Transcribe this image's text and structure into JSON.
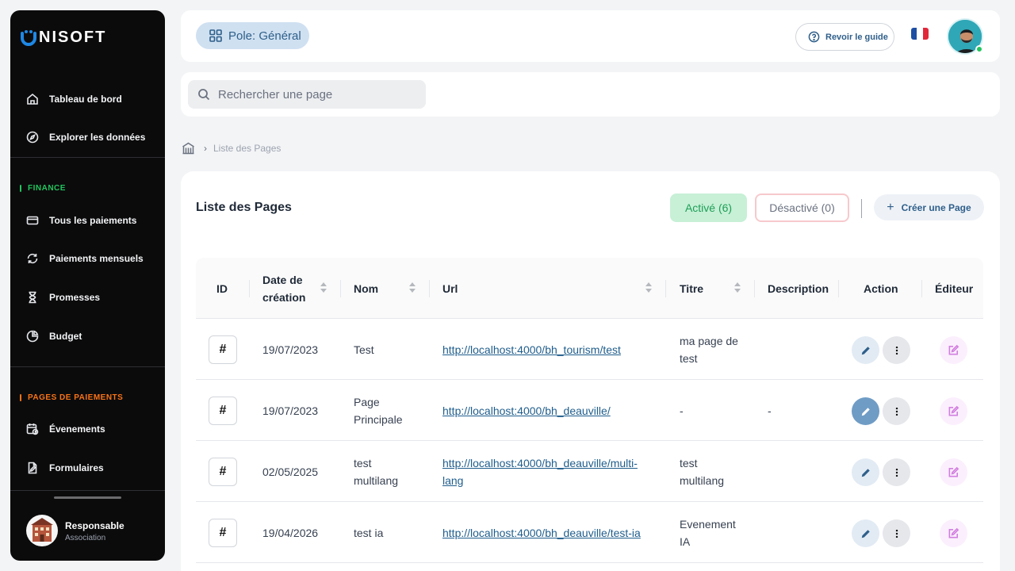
{
  "brand": {
    "name": "NISOFT"
  },
  "sidebar": {
    "top_items": [
      {
        "label": "Tableau de bord",
        "icon": "home-icon"
      },
      {
        "label": "Explorer les données",
        "icon": "compass-icon"
      }
    ],
    "sections": [
      {
        "title": "FINANCE",
        "color": "#22c55e",
        "items": [
          {
            "label": "Tous les paiements",
            "icon": "credit-card-icon"
          },
          {
            "label": "Paiements mensuels",
            "icon": "refresh-icon"
          },
          {
            "label": "Promesses",
            "icon": "hourglass-icon"
          },
          {
            "label": "Budget",
            "icon": "pie-chart-icon"
          }
        ]
      },
      {
        "title": "PAGES DE PAIEMENTS",
        "color": "#f97316",
        "items": [
          {
            "label": "Évenements",
            "icon": "calendar-clock-icon"
          },
          {
            "label": "Formulaires",
            "icon": "file-edit-icon"
          }
        ]
      }
    ],
    "user": {
      "name": "Responsable",
      "role": "Association"
    }
  },
  "header": {
    "pole_label": "Pole: Général",
    "guide_label": "Revoir le guide",
    "language_flag": "fr-flag-icon"
  },
  "search": {
    "placeholder": "Rechercher une page"
  },
  "breadcrumb": {
    "current": "Liste des Pages"
  },
  "main": {
    "title": "Liste des Pages",
    "active_filter": "Activé (6)",
    "inactive_filter": "Désactivé (0)",
    "create_label": "Créer une Page",
    "columns": [
      "ID",
      "Date de création",
      "Nom",
      "Url",
      "Titre",
      "Description",
      "Action",
      "Éditeur"
    ],
    "rows": [
      {
        "id": "#",
        "date": "19/07/2023",
        "name": "Test",
        "url": "http://localhost:4000/bh_tourism/test",
        "title": "ma page de test",
        "description": ""
      },
      {
        "id": "#",
        "date": "19/07/2023",
        "name": "Page Principale",
        "url": "http://localhost:4000/bh_deauville/",
        "title": "-",
        "description": "-"
      },
      {
        "id": "#",
        "date": "02/05/2025",
        "name": "test multilang",
        "url": "http://localhost:4000/bh_deauville/multi-lang",
        "title": "test multilang",
        "description": ""
      },
      {
        "id": "#",
        "date": "19/04/2026",
        "name": "test ia",
        "url": "http://localhost:4000/bh_deauville/test-ia",
        "title": "Evenement IA",
        "description": ""
      }
    ]
  },
  "colors": {
    "accent": "#2f5f8a",
    "active_green": "#1e9e57",
    "inactive_border": "#f7c9cd"
  }
}
